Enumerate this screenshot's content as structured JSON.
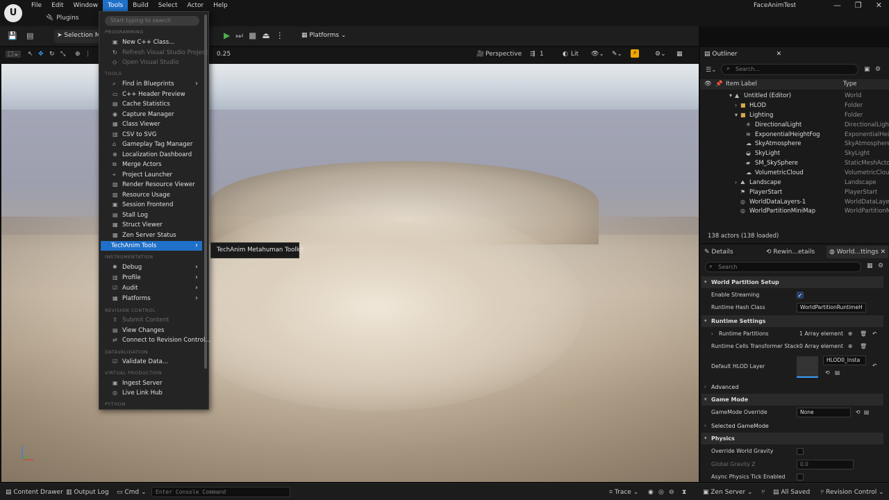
{
  "menubar": {
    "items": [
      "File",
      "Edit",
      "Window",
      "Tools",
      "Build",
      "Select",
      "Actor",
      "Help"
    ],
    "active": "Tools"
  },
  "plugins_label": "Plugins",
  "window_title": "FaceAnimTest",
  "toolbar": {
    "selection_mode": "Selection Mode",
    "platforms": "Platforms"
  },
  "viewport_toolbar": {
    "snap_value": "0.25",
    "perspective": "Perspective",
    "camera_speed": "1",
    "view_mode": "Lit"
  },
  "tools_menu": {
    "search_placeholder": "Start typing to search",
    "sections": {
      "programming": "PROGRAMMING",
      "tools": "TOOLS",
      "instrumentation": "INSTRUMENTATION",
      "revision_control": "REVISION CONTROL",
      "datavalidation": "DATAVALIDATION",
      "virtual_production": "VIRTUAL PRODUCTION",
      "python": "PYTHON"
    },
    "items": {
      "new_cpp_class": "New C++ Class...",
      "refresh_vs": "Refresh Visual Studio Project",
      "open_vs": "Open Visual Studio",
      "find_in_blueprints": "Find in Blueprints",
      "cpp_header_preview": "C++ Header Preview",
      "cache_statistics": "Cache Statistics",
      "capture_manager": "Capture Manager",
      "class_viewer": "Class Viewer",
      "csv_to_svg": "CSV to SVG",
      "gameplay_tag_manager": "Gameplay Tag Manager",
      "localization_dashboard": "Localization Dashboard",
      "merge_actors": "Merge Actors",
      "project_launcher": "Project Launcher",
      "render_resource_viewer": "Render Resource Viewer",
      "resource_usage": "Resource Usage",
      "session_frontend": "Session Frontend",
      "stall_log": "Stall Log",
      "struct_viewer": "Struct Viewer",
      "zen_server_status": "Zen Server Status",
      "techanim_tools": "TechAnim Tools",
      "debug": "Debug",
      "profile": "Profile",
      "audit": "Audit",
      "platforms": "Platforms",
      "submit_content": "Submit Content",
      "view_changes": "View Changes",
      "connect_revision": "Connect to Revision Control...",
      "validate_data": "Validate Data...",
      "ingest_server": "Ingest Server",
      "live_link_hub": "Live Link Hub"
    },
    "submenu_item": "TechAnim Metahuman Toolkit"
  },
  "outliner": {
    "title": "Outliner",
    "search_placeholder": "Search...",
    "col_label": "Item Label",
    "col_type": "Type",
    "rows": [
      {
        "name": "Untitled (Editor)",
        "type": "World"
      },
      {
        "name": "HLOD",
        "type": "Folder"
      },
      {
        "name": "Lighting",
        "type": "Folder"
      },
      {
        "name": "DirectionalLight",
        "type": "DirectionalLight"
      },
      {
        "name": "ExponentialHeightFog",
        "type": "ExponentialHeig"
      },
      {
        "name": "SkyAtmosphere",
        "type": "SkyAtmosphere"
      },
      {
        "name": "SkyLight",
        "type": "SkyLight"
      },
      {
        "name": "SM_SkySphere",
        "type": "StaticMeshActor"
      },
      {
        "name": "VolumetricCloud",
        "type": "VolumetricCloud"
      },
      {
        "name": "Landscape",
        "type": "Landscape"
      },
      {
        "name": "PlayerStart",
        "type": "PlayerStart"
      },
      {
        "name": "WorldDataLayers-1",
        "type": "WorldDataLayer"
      },
      {
        "name": "WorldPartitionMiniMap",
        "type": "WorldPartitionM"
      }
    ],
    "actor_count": "138 actors (138 loaded)"
  },
  "details": {
    "tabs": [
      "Details",
      "Rewin...etails",
      "World...ttings"
    ],
    "search_placeholder": "Search",
    "sections": {
      "world_partition_setup": "World Partition Setup",
      "runtime_settings": "Runtime Settings",
      "advanced": "Advanced",
      "game_mode": "Game Mode",
      "selected_gamemode": "Selected GameMode",
      "physics": "Physics"
    },
    "props": {
      "enable_streaming": "Enable Streaming",
      "runtime_hash_class": "Runtime Hash Class",
      "runtime_hash_value": "WorldPartitionRuntimeH",
      "runtime_partitions": "Runtime Partitions",
      "runtime_partitions_val": "1 Array element",
      "cells_transformer": "Runtime Cells Transformer Stack",
      "cells_transformer_val": "0 Array element",
      "default_hlod_layer": "Default HLOD Layer",
      "hlod_value": "HLOD0_Insta",
      "gamemode_override": "GameMode Override",
      "gamemode_value": "None",
      "override_gravity": "Override World Gravity",
      "global_gravity": "Global Gravity Z",
      "global_gravity_val": "0.0",
      "async_physics": "Async Physics Tick Enabled"
    }
  },
  "statusbar": {
    "content_drawer": "Content Drawer",
    "output_log": "Output Log",
    "cmd": "Cmd",
    "console_placeholder": "Enter Console Command",
    "trace": "Trace",
    "zen_server": "Zen Server",
    "all_saved": "All Saved",
    "revision_control": "Revision Control"
  }
}
